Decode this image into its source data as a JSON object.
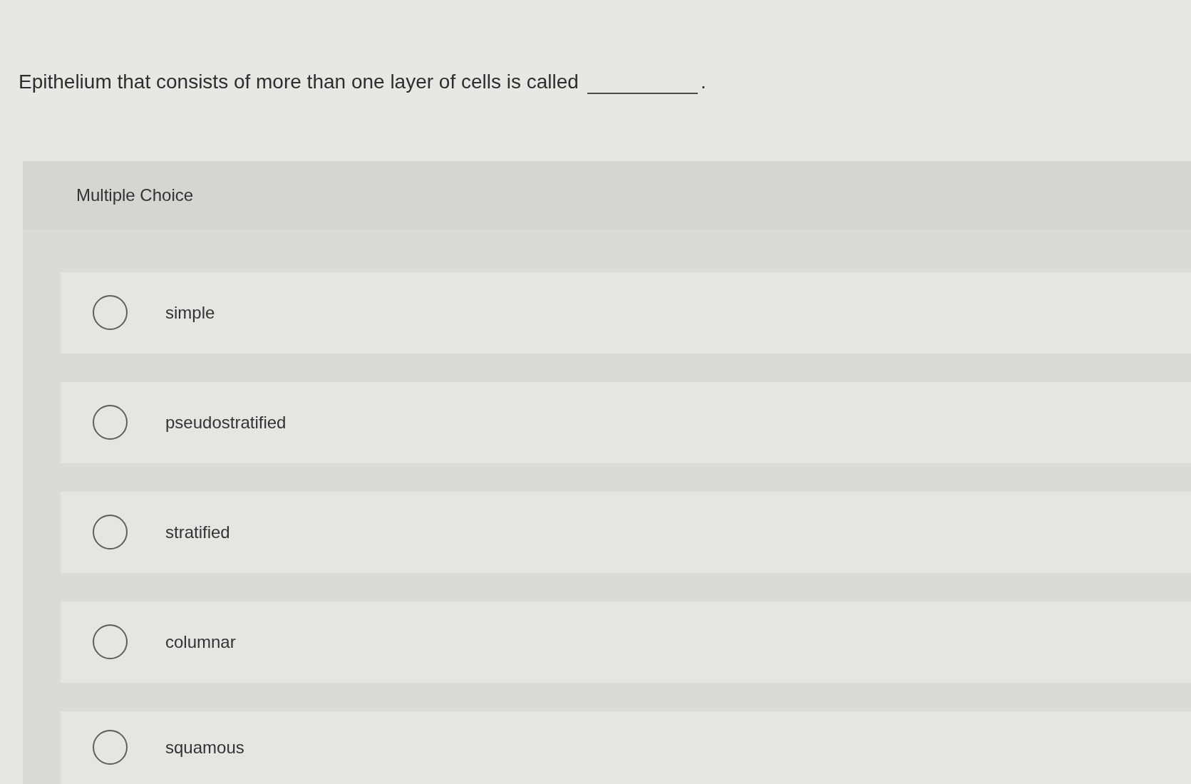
{
  "question": {
    "text": "Epithelium that consists of more than one layer of cells is called",
    "text_after_blank": "."
  },
  "answer_panel": {
    "title": "Multiple Choice",
    "options": [
      {
        "label": "simple",
        "selected": false
      },
      {
        "label": "pseudostratified",
        "selected": false
      },
      {
        "label": "stratified",
        "selected": false
      },
      {
        "label": "columnar",
        "selected": false
      },
      {
        "label": "squamous",
        "selected": false
      }
    ]
  }
}
